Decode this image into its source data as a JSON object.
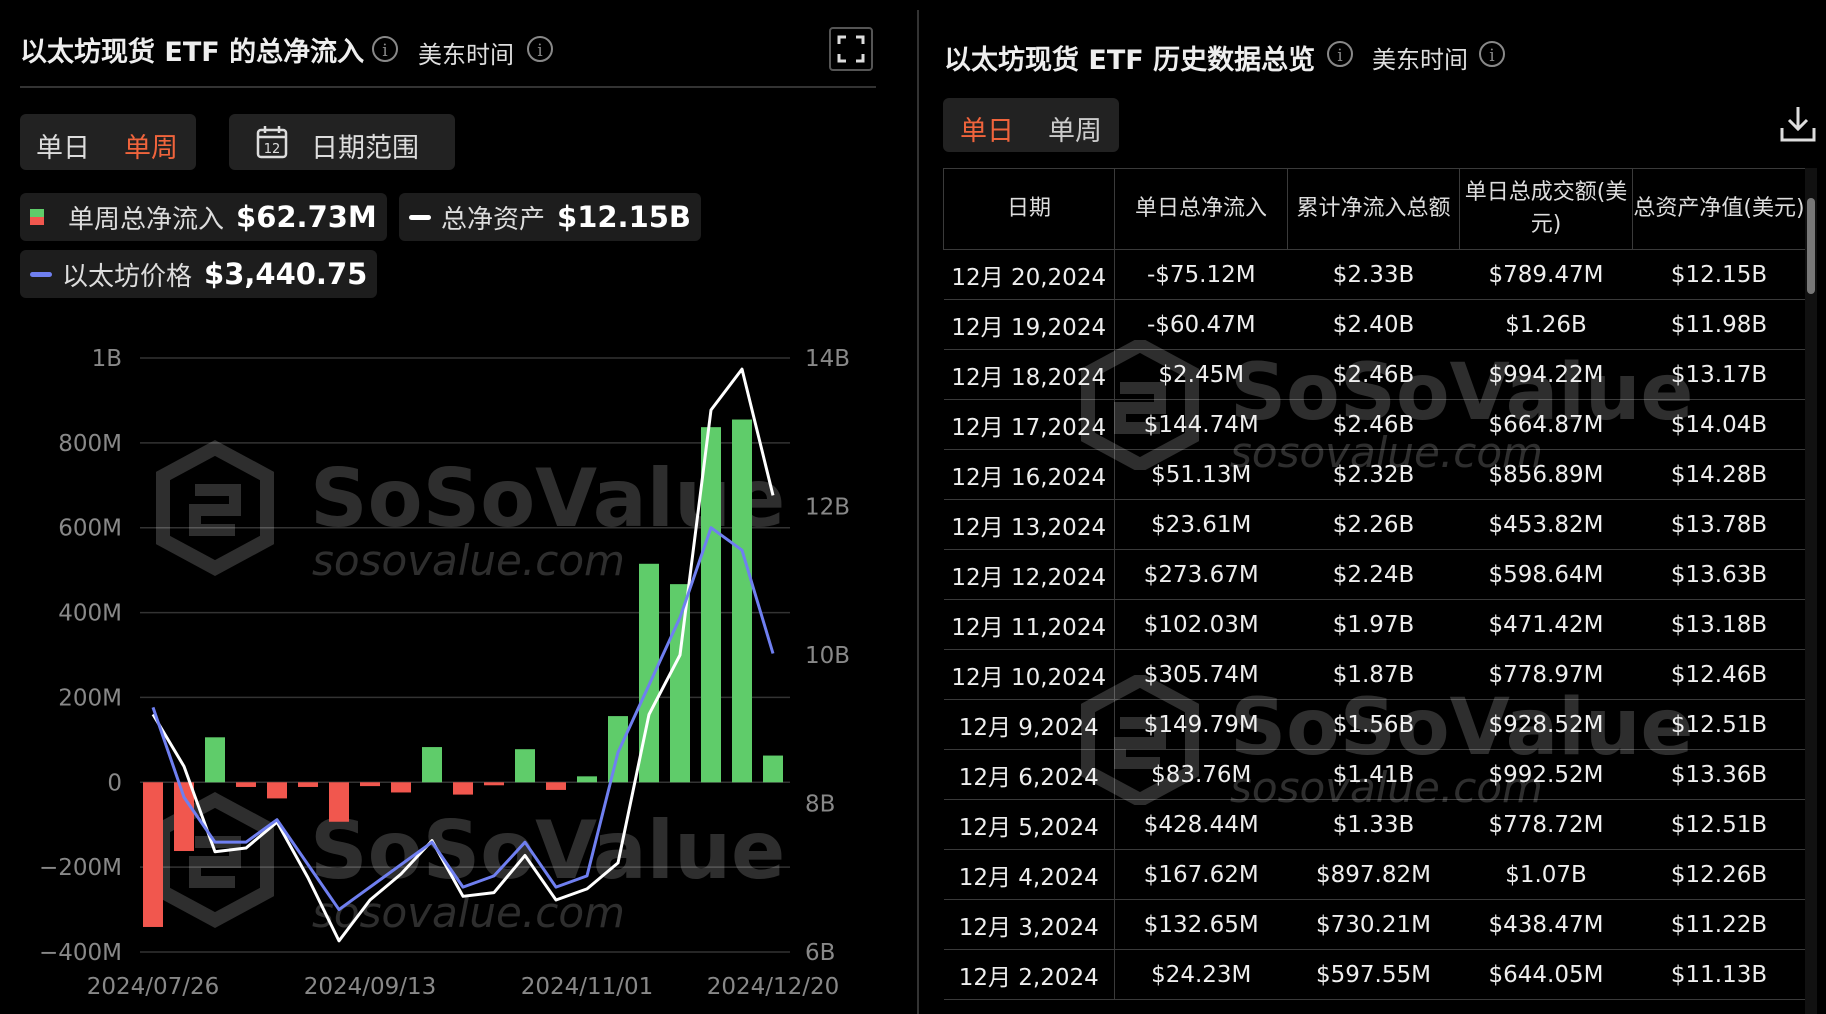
{
  "left": {
    "title": "以太坊现货 ETF 的总净流入",
    "timezone": "美东时间",
    "tabs": [
      "单日",
      "单周"
    ],
    "active_tab": "单周",
    "date_range_label": "日期范围",
    "calendar_day": "12",
    "legend": {
      "weekly_net_label": "单周总净流入",
      "weekly_net_value": "$62.73M",
      "total_assets_label": "总净资产",
      "total_assets_value": "$12.15B",
      "eth_price_label": "以太坊价格",
      "eth_price_value": "$3,440.75"
    }
  },
  "right": {
    "title": "以太坊现货 ETF 历史数据总览",
    "timezone": "美东时间",
    "tabs": [
      "单日",
      "单周"
    ],
    "active_tab": "单日",
    "columns": [
      "日期",
      "单日总净流入",
      "累计净流入总额",
      "单日总成交额(美元)",
      "总资产净值(美元)"
    ],
    "rows": [
      [
        "12月 20,2024",
        "-$75.12M",
        "$2.33B",
        "$789.47M",
        "$12.15B"
      ],
      [
        "12月 19,2024",
        "-$60.47M",
        "$2.40B",
        "$1.26B",
        "$11.98B"
      ],
      [
        "12月 18,2024",
        "$2.45M",
        "$2.46B",
        "$994.22M",
        "$13.17B"
      ],
      [
        "12月 17,2024",
        "$144.74M",
        "$2.46B",
        "$664.87M",
        "$14.04B"
      ],
      [
        "12月 16,2024",
        "$51.13M",
        "$2.32B",
        "$856.89M",
        "$14.28B"
      ],
      [
        "12月 13,2024",
        "$23.61M",
        "$2.26B",
        "$453.82M",
        "$13.78B"
      ],
      [
        "12月 12,2024",
        "$273.67M",
        "$2.24B",
        "$598.64M",
        "$13.63B"
      ],
      [
        "12月 11,2024",
        "$102.03M",
        "$1.97B",
        "$471.42M",
        "$13.18B"
      ],
      [
        "12月 10,2024",
        "$305.74M",
        "$1.87B",
        "$778.97M",
        "$12.46B"
      ],
      [
        "12月 9,2024",
        "$149.79M",
        "$1.56B",
        "$928.52M",
        "$12.51B"
      ],
      [
        "12月 6,2024",
        "$83.76M",
        "$1.41B",
        "$992.52M",
        "$13.36B"
      ],
      [
        "12月 5,2024",
        "$428.44M",
        "$1.33B",
        "$778.72M",
        "$12.51B"
      ],
      [
        "12月 4,2024",
        "$167.62M",
        "$897.82M",
        "$1.07B",
        "$12.26B"
      ],
      [
        "12月 3,2024",
        "$132.65M",
        "$730.21M",
        "$438.47M",
        "$11.22B"
      ],
      [
        "12月 2,2024",
        "$24.23M",
        "$597.55M",
        "$644.05M",
        "$11.13B"
      ]
    ]
  },
  "watermark": {
    "brand": "SoSoValue",
    "site": "sosovalue.com"
  },
  "colors": {
    "positive": "#5fcc6a",
    "negative": "#f1574e",
    "active_tab": "#f0643c",
    "eth_line": "#6f7ff0",
    "assets_line": "#ffffff",
    "background": "#000000"
  },
  "chart_data": {
    "type": "bar",
    "x_tick_labels": [
      "2024/07/26",
      "2024/09/13",
      "2024/11/01",
      "2024/12/20"
    ],
    "left_axis": {
      "ticks": [
        "1B",
        "800M",
        "600M",
        "400M",
        "200M",
        "0",
        "−200M",
        "−400M"
      ],
      "ylim": [
        -400,
        1000
      ],
      "unit": "M"
    },
    "right_axis": {
      "ticks": [
        "14B",
        "12B",
        "10B",
        "8B",
        "6B"
      ],
      "ylim": [
        6,
        14
      ],
      "unit": "B"
    },
    "series": [
      {
        "name": "单周总净流入",
        "type": "bar",
        "values": [
          -341,
          -162,
          106,
          -11,
          -38,
          -11,
          -93,
          -9,
          -24,
          83,
          -29,
          -2,
          78,
          -18,
          14,
          156,
          515,
          467,
          837,
          855,
          63
        ]
      },
      {
        "name": "总净资产",
        "type": "line",
        "values": [
          9.2,
          8.5,
          7.35,
          7.4,
          7.75,
          7.0,
          6.15,
          6.7,
          7.05,
          7.5,
          6.75,
          6.8,
          7.3,
          6.7,
          6.85,
          7.2,
          9.2,
          10.0,
          13.3,
          13.85,
          12.15
        ]
      },
      {
        "name": "以太坊价格",
        "type": "line",
        "values": [
          3200,
          2800,
          2600,
          2600,
          2700,
          2500,
          2300,
          2400,
          2500,
          2600,
          2400,
          2450,
          2600,
          2400,
          2450,
          3000,
          3300,
          3600,
          4000,
          3900,
          3440
        ]
      }
    ]
  }
}
